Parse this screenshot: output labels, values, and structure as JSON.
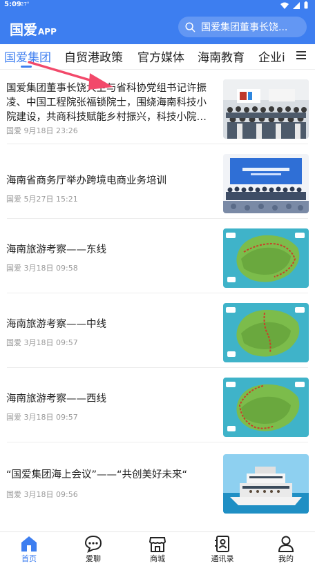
{
  "status": {
    "time": "5:09",
    "temp": "27°"
  },
  "header": {
    "title": "国爱",
    "title_suffix": "APP",
    "search_placeholder": "国爱集团董事长饶..."
  },
  "tabs": [
    "国爱集团",
    "自贸港政策",
    "官方媒体",
    "海南教育",
    "企业i"
  ],
  "news": [
    {
      "title": "国爱集团董事长饶大卫与省科协党组书记许振凌、中国工程院张福锁院士，围绕海南科技小院建设，共商科技赋能乡村振兴，科技小院…",
      "source": "国爱",
      "date": "9月18日 23:26",
      "thumb": "group-photo"
    },
    {
      "title": "海南省商务厅举办跨境电商业务培训",
      "source": "国爱",
      "date": "5月27日 15:21",
      "thumb": "conference"
    },
    {
      "title": "海南旅游考察——东线",
      "source": "国爱",
      "date": "3月18日 09:58",
      "thumb": "map-east"
    },
    {
      "title": "海南旅游考察——中线",
      "source": "国爱",
      "date": "3月18日 09:57",
      "thumb": "map-central"
    },
    {
      "title": "海南旅游考察——西线",
      "source": "国爱",
      "date": "3月18日 09:57",
      "thumb": "map-west"
    },
    {
      "title": "“国爱集团海上会议”——“共创美好未来“",
      "source": "国爱",
      "date": "3月18日 09:56",
      "thumb": "yacht"
    }
  ],
  "bottom_nav": [
    {
      "label": "首页",
      "icon": "home-icon"
    },
    {
      "label": "爱聊",
      "icon": "chat-icon"
    },
    {
      "label": "商城",
      "icon": "shop-icon"
    },
    {
      "label": "通讯录",
      "icon": "contacts-icon"
    },
    {
      "label": "我的",
      "icon": "profile-icon"
    }
  ],
  "colors": {
    "accent": "#3d7ef0",
    "arrow": "#f2496a"
  }
}
